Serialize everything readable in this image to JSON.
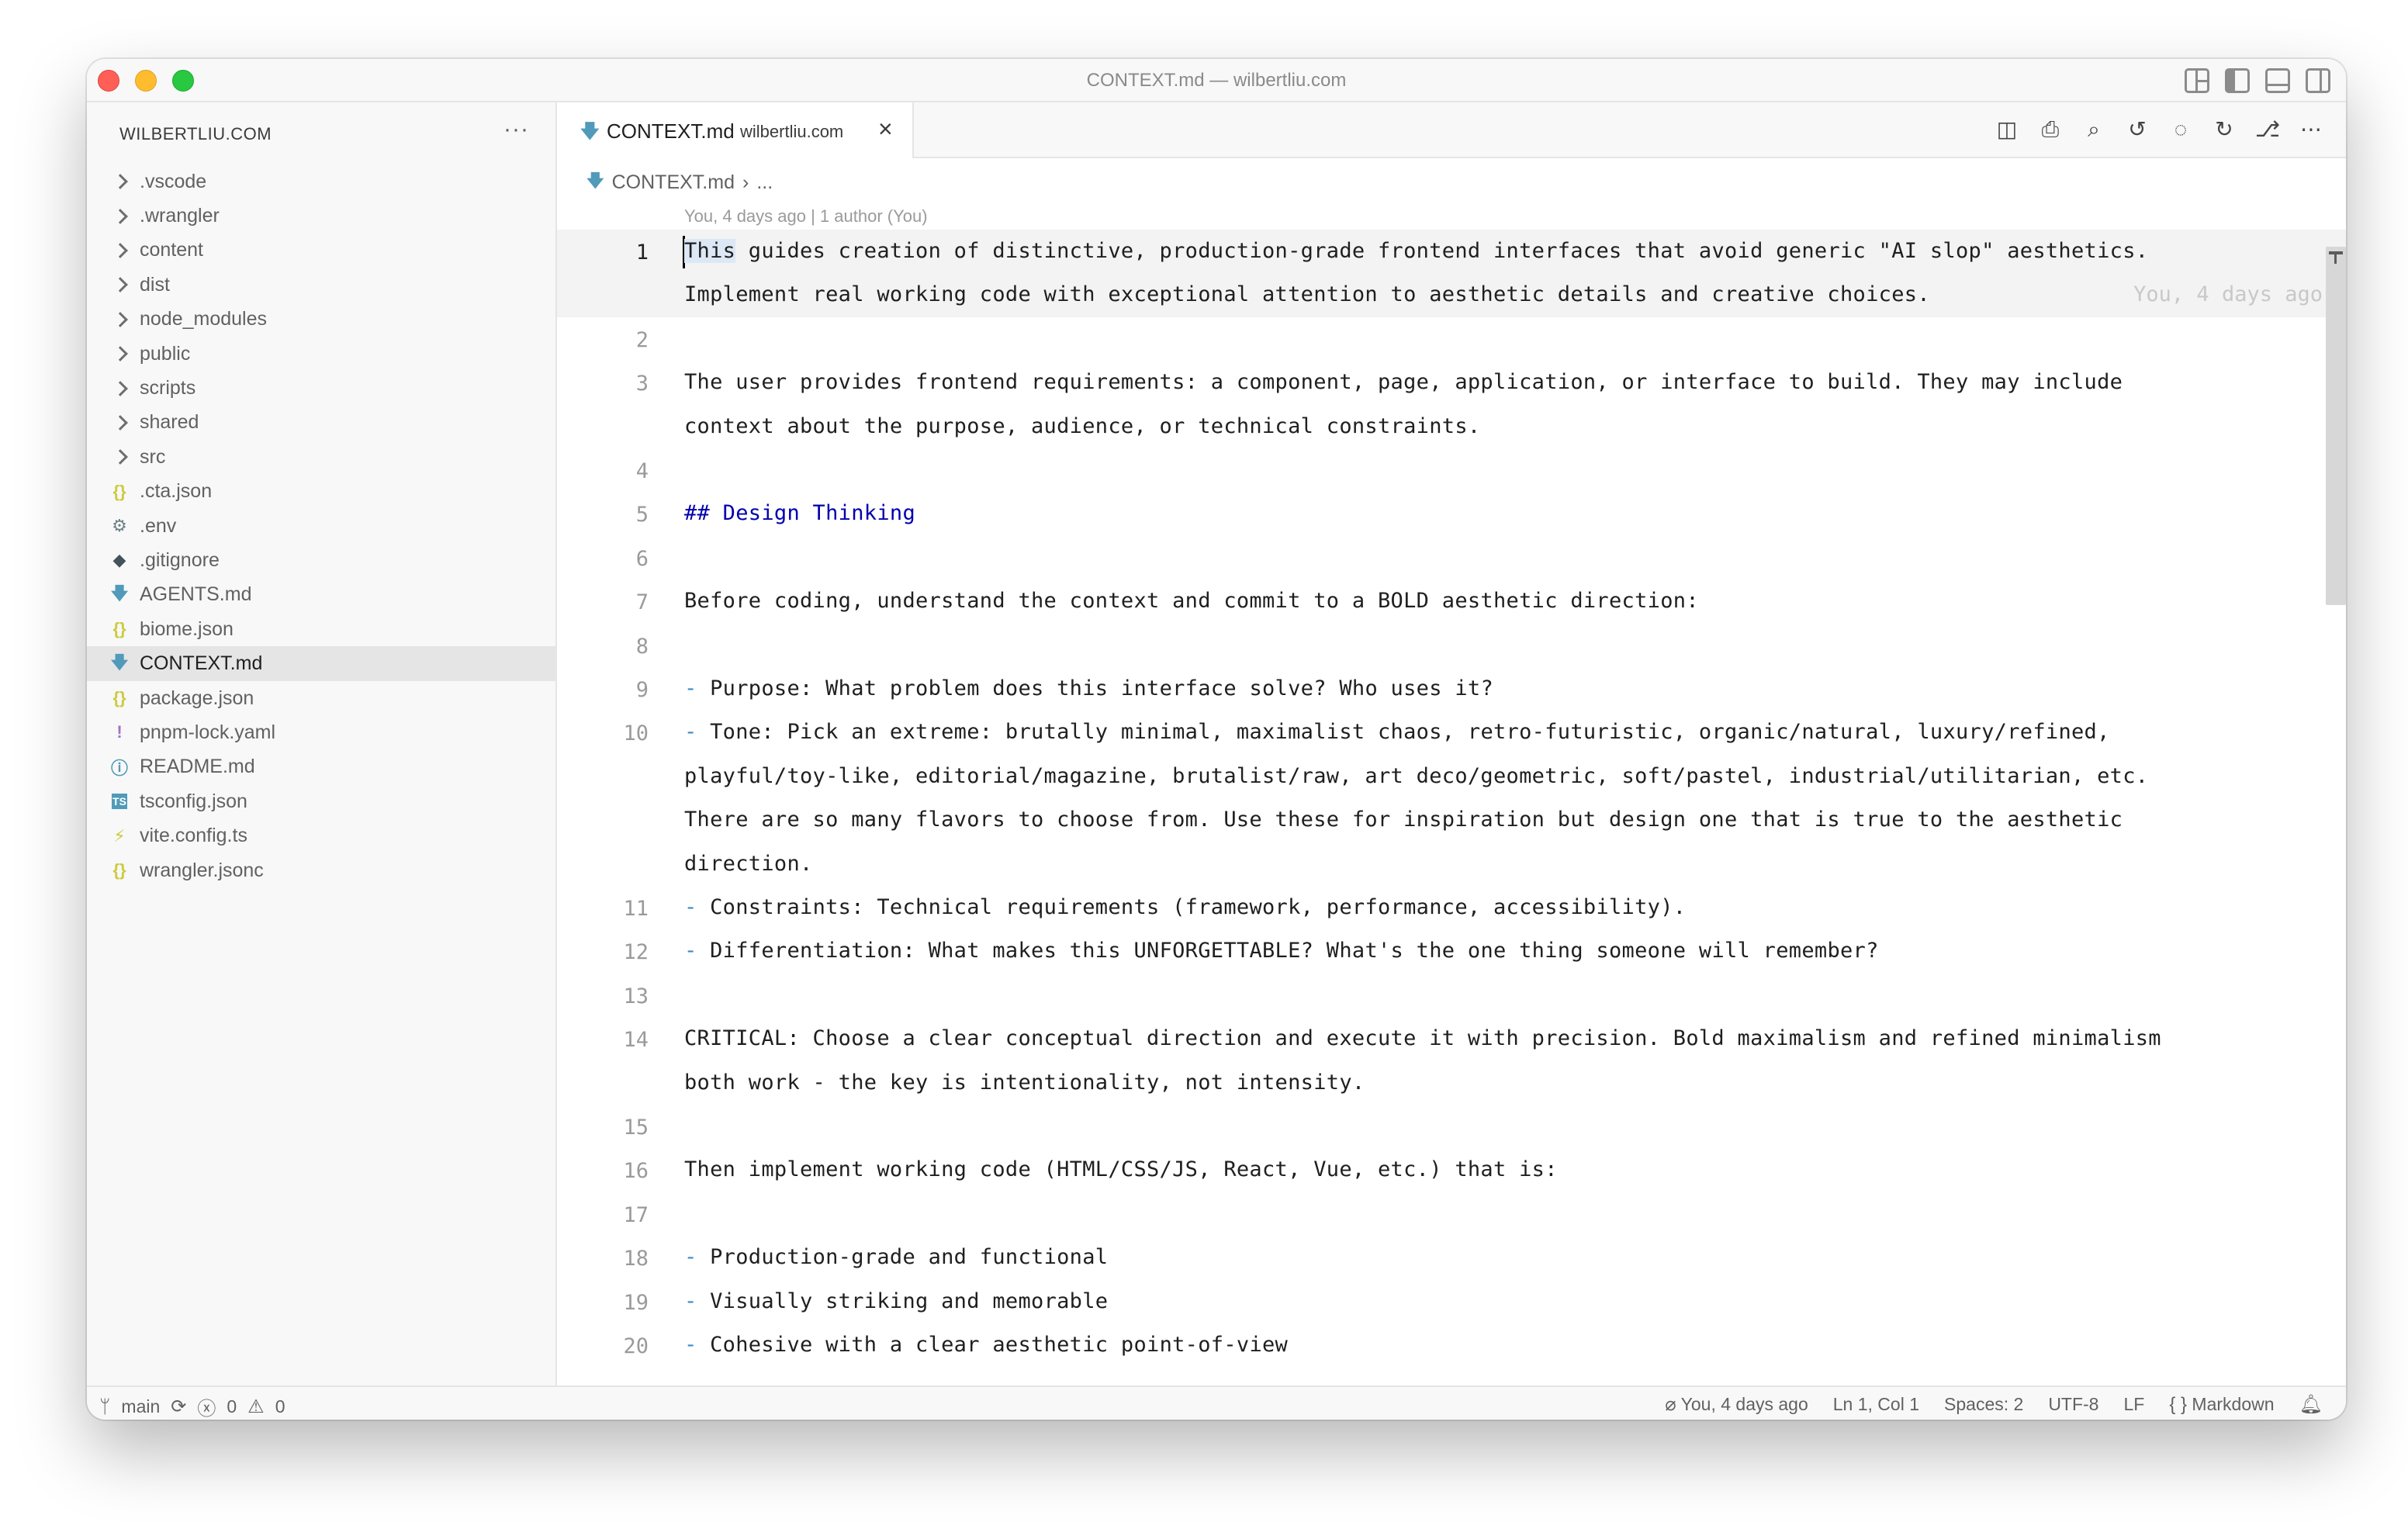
{
  "window": {
    "title": "CONTEXT.md — wilbertliu.com"
  },
  "explorer": {
    "title": "WILBERTLIU.COM",
    "more": "···",
    "items": [
      {
        "label": ".vscode",
        "type": "folder"
      },
      {
        "label": ".wrangler",
        "type": "folder"
      },
      {
        "label": "content",
        "type": "folder"
      },
      {
        "label": "dist",
        "type": "folder"
      },
      {
        "label": "node_modules",
        "type": "folder"
      },
      {
        "label": "public",
        "type": "folder"
      },
      {
        "label": "scripts",
        "type": "folder"
      },
      {
        "label": "shared",
        "type": "folder"
      },
      {
        "label": "src",
        "type": "folder"
      },
      {
        "label": ".cta.json",
        "type": "json"
      },
      {
        "label": ".env",
        "type": "env"
      },
      {
        "label": ".gitignore",
        "type": "git"
      },
      {
        "label": "AGENTS.md",
        "type": "md"
      },
      {
        "label": "biome.json",
        "type": "json"
      },
      {
        "label": "CONTEXT.md",
        "type": "md",
        "selected": true
      },
      {
        "label": "package.json",
        "type": "json"
      },
      {
        "label": "pnpm-lock.yaml",
        "type": "yaml"
      },
      {
        "label": "README.md",
        "type": "info"
      },
      {
        "label": "tsconfig.json",
        "type": "ts"
      },
      {
        "label": "vite.config.ts",
        "type": "vite"
      },
      {
        "label": "wrangler.jsonc",
        "type": "json"
      }
    ]
  },
  "tab": {
    "name": "CONTEXT.md",
    "description": "wilbertliu.com",
    "close": "×"
  },
  "breadcrumb": {
    "file": "CONTEXT.md",
    "rest": "..."
  },
  "blame": {
    "header": "You, 4 days ago | 1 author (You)",
    "inline": "You, 4 days ago"
  },
  "lines": [
    {
      "n": "1",
      "t": "This guides creation of distinctive, production-grade frontend interfaces that avoid generic \"AI slop\" aesthetics."
    },
    {
      "n": "",
      "t": "Implement real working code with exceptional attention to aesthetic details and creative choices."
    },
    {
      "n": "2",
      "t": ""
    },
    {
      "n": "3",
      "t": "The user provides frontend requirements: a component, page, application, or interface to build. They may include"
    },
    {
      "n": "",
      "t": "context about the purpose, audience, or technical constraints."
    },
    {
      "n": "4",
      "t": ""
    },
    {
      "n": "5",
      "t": "## Design Thinking"
    },
    {
      "n": "6",
      "t": ""
    },
    {
      "n": "7",
      "t": "Before coding, understand the context and commit to a BOLD aesthetic direction:"
    },
    {
      "n": "8",
      "t": ""
    },
    {
      "n": "9",
      "t": "Purpose: What problem does this interface solve? Who uses it?"
    },
    {
      "n": "10",
      "t": "Tone: Pick an extreme: brutally minimal, maximalist chaos, retro-futuristic, organic/natural, luxury/refined,"
    },
    {
      "n": "",
      "t": "playful/toy-like, editorial/magazine, brutalist/raw, art deco/geometric, soft/pastel, industrial/utilitarian, etc."
    },
    {
      "n": "",
      "t": "There are so many flavors to choose from. Use these for inspiration but design one that is true to the aesthetic"
    },
    {
      "n": "",
      "t": "direction."
    },
    {
      "n": "11",
      "t": "Constraints: Technical requirements (framework, performance, accessibility)."
    },
    {
      "n": "12",
      "t": "Differentiation: What makes this UNFORGETTABLE? What's the one thing someone will remember?"
    },
    {
      "n": "13",
      "t": ""
    },
    {
      "n": "14",
      "t": "CRITICAL: Choose a clear conceptual direction and execute it with precision. Bold maximalism and refined minimalism"
    },
    {
      "n": "",
      "t": "both work - the key is intentionality, not intensity."
    },
    {
      "n": "15",
      "t": ""
    },
    {
      "n": "16",
      "t": "Then implement working code (HTML/CSS/JS, React, Vue, etc.) that is:"
    },
    {
      "n": "17",
      "t": ""
    },
    {
      "n": "18",
      "t": "Production-grade and functional"
    },
    {
      "n": "19",
      "t": "Visually striking and memorable"
    },
    {
      "n": "20",
      "t": "Cohesive with a clear aesthetic point-of-view"
    }
  ],
  "line1": {
    "first_word": "This",
    "rest": " guides creation of distinctive, production-grade frontend interfaces that avoid generic \"AI slop\" aesthetics."
  },
  "bullet": "-",
  "status": {
    "branch": "main",
    "errors": "0",
    "warnings": "0",
    "blame": "You, 4 days ago",
    "position": "Ln 1, Col 1",
    "spaces": "Spaces: 2",
    "encoding": "UTF-8",
    "eol": "LF",
    "language": "Markdown"
  }
}
